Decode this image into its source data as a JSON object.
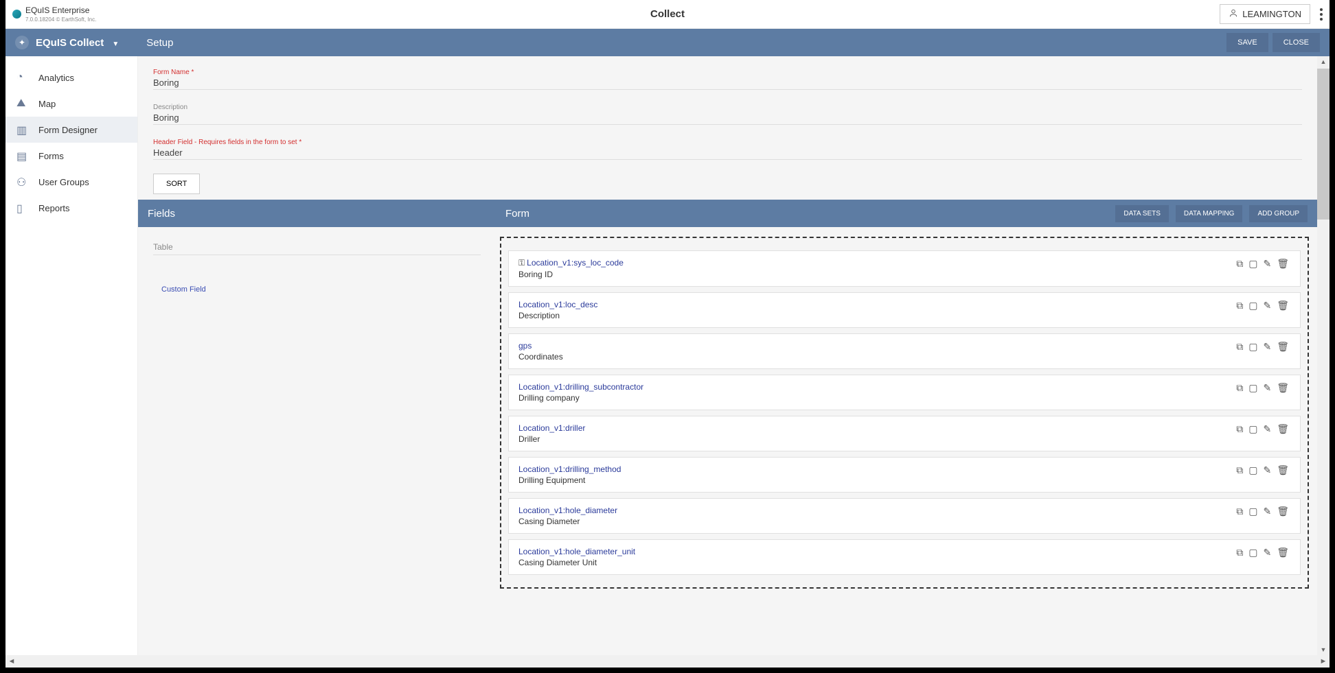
{
  "topbar": {
    "app_name": "EQuIS Enterprise",
    "version": "7.0.0.18204 © EarthSoft, Inc.",
    "title": "Collect",
    "user": "LEAMINGTON"
  },
  "bluebar": {
    "app": "EQuIS Collect",
    "crumb": "Setup",
    "save": "SAVE",
    "close": "CLOSE"
  },
  "sidebar": {
    "items": {
      "0": {
        "label": "Analytics"
      },
      "1": {
        "label": "Map"
      },
      "2": {
        "label": "Form Designer"
      },
      "3": {
        "label": "Forms"
      },
      "4": {
        "label": "User Groups"
      },
      "5": {
        "label": "Reports"
      }
    }
  },
  "setup": {
    "form_name_label": "Form Name *",
    "form_name_value": "Boring",
    "desc_label": "Description",
    "desc_value": "Boring",
    "header_label": "Header Field - Requires fields in the form to set *",
    "header_value": "Header",
    "sort": "SORT"
  },
  "twocol": {
    "fields_title": "Fields",
    "form_title": "Form",
    "data_sets": "DATA SETS",
    "data_mapping": "DATA MAPPING",
    "add_group": "ADD GROUP",
    "table_label": "Table",
    "custom_field": "Custom Field"
  },
  "form_fields": {
    "0": {
      "id": "Location_v1:sys_loc_code",
      "desc": "Boring ID",
      "key": true
    },
    "1": {
      "id": "Location_v1:loc_desc",
      "desc": "Description",
      "key": false
    },
    "2": {
      "id": "gps",
      "desc": "Coordinates",
      "key": false
    },
    "3": {
      "id": "Location_v1:drilling_subcontractor",
      "desc": "Drilling company",
      "key": false
    },
    "4": {
      "id": "Location_v1:driller",
      "desc": "Driller",
      "key": false
    },
    "5": {
      "id": "Location_v1:drilling_method",
      "desc": "Drilling Equipment",
      "key": false
    },
    "6": {
      "id": "Location_v1:hole_diameter",
      "desc": "Casing Diameter",
      "key": false
    },
    "7": {
      "id": "Location_v1:hole_diameter_unit",
      "desc": "Casing Diameter Unit",
      "key": false
    }
  }
}
